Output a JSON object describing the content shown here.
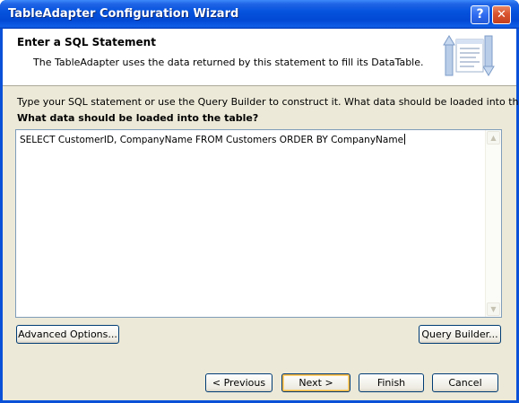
{
  "window": {
    "title": "TableAdapter Configuration Wizard",
    "help_glyph": "?",
    "close_glyph": "✕"
  },
  "header": {
    "title": "Enter a SQL Statement",
    "description": "The TableAdapter uses the data returned by this statement to fill its DataTable.",
    "icon": "wizard-banner-icon"
  },
  "body": {
    "instruction": "Type your SQL statement or use the Query Builder to construct it. What data should be loaded into the table?",
    "question": "What data should be loaded into the table?",
    "sql_text": "SELECT CustomerID, CompanyName FROM Customers ORDER BY CompanyName"
  },
  "buttons": {
    "advanced_options": "Advanced Options...",
    "query_builder": "Query Builder...",
    "previous": "< Previous",
    "next": "Next >",
    "finish": "Finish",
    "cancel": "Cancel"
  },
  "colors": {
    "titlebar": "#0553de",
    "dialog_bg": "#ece9d8",
    "button_border": "#003c74",
    "default_button_highlight": "#f8b33c"
  }
}
